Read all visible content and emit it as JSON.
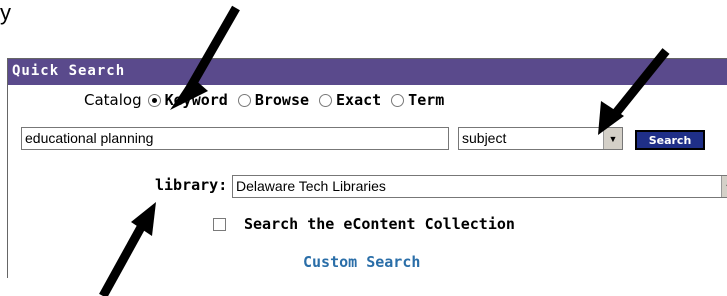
{
  "top_text": "y",
  "panel": {
    "title": "Quick Search",
    "catalog_label": "Catalog",
    "options": [
      {
        "label": "Keyword",
        "selected": true
      },
      {
        "label": "Browse",
        "selected": false
      },
      {
        "label": "Exact",
        "selected": false
      },
      {
        "label": "Term",
        "selected": false
      }
    ],
    "search_value": "educational planning",
    "search_field_select": "subject",
    "search_button": "Search",
    "library_label": "library:",
    "library_value": "Delaware Tech Libraries",
    "econtent_label": "Search the eContent Collection",
    "econtent_checked": false,
    "custom_search": "Custom Search"
  },
  "colors": {
    "header_bg": "#5a4a8c",
    "button_bg": "#1f2f88",
    "link": "#2a6ea8"
  },
  "icons": {
    "select_arrow": "chevron-down-icon",
    "annotation_arrow": "arrow-icon"
  }
}
